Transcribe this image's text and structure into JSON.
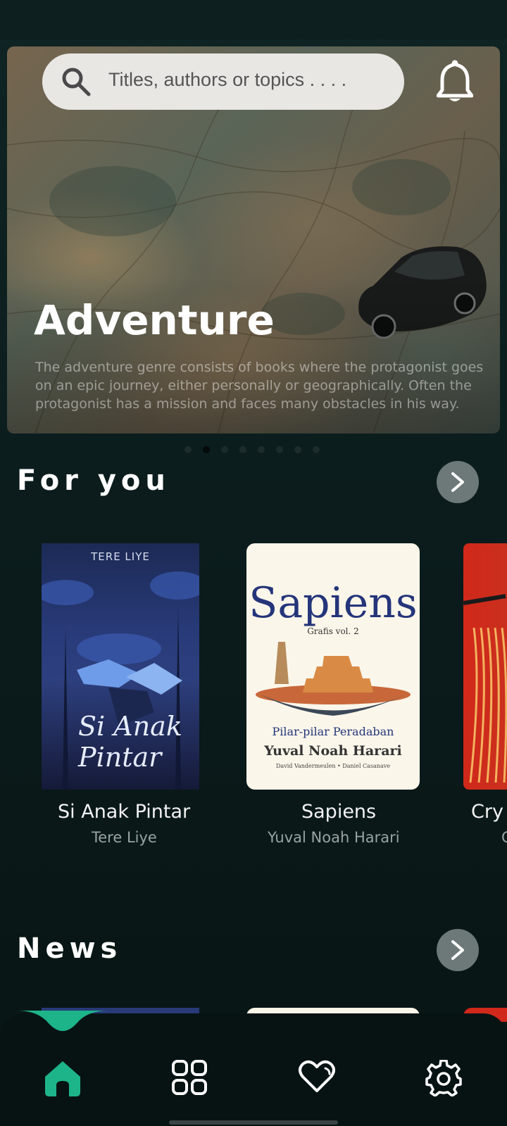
{
  "search": {
    "placeholder": "Titles, authors or topics . . . ."
  },
  "hero": {
    "title": "Adventure",
    "description": "The adventure genre consists of books where the protagonist goes on an epic journey, either personally or geographically. Often the protagonist has a mission and faces many obstacles in his way.",
    "carousel_total": 8,
    "carousel_active_index": 1
  },
  "for_you": {
    "title": "For you",
    "books": [
      {
        "title": "Si Anak Pintar",
        "author": "Tere Liye",
        "cover_top": "TERE LIYE",
        "cover_title_1": "Si Anak",
        "cover_title_2": "Pintar"
      },
      {
        "title": "Sapiens",
        "author": "Yuval Noah Harari",
        "cover_title": "Sapiens",
        "cover_sub": "Grafis vol. 2",
        "cover_line": "Pilar-pilar Peradaban",
        "cover_author": "Yuval Noah Harari",
        "cover_credits": "David Vandermeulen • Daniel Casanave"
      },
      {
        "title": "Cry",
        "author": "C"
      }
    ]
  },
  "news": {
    "title": "News"
  },
  "nav": {
    "items": [
      "home-icon",
      "grid-icon",
      "heart-icon",
      "settings-icon"
    ],
    "active": "home-icon",
    "accent": "#1db48a"
  },
  "colors": {
    "accent": "#1db48a",
    "background": "#0c1d1d",
    "arrow_button": "#6d7979"
  }
}
